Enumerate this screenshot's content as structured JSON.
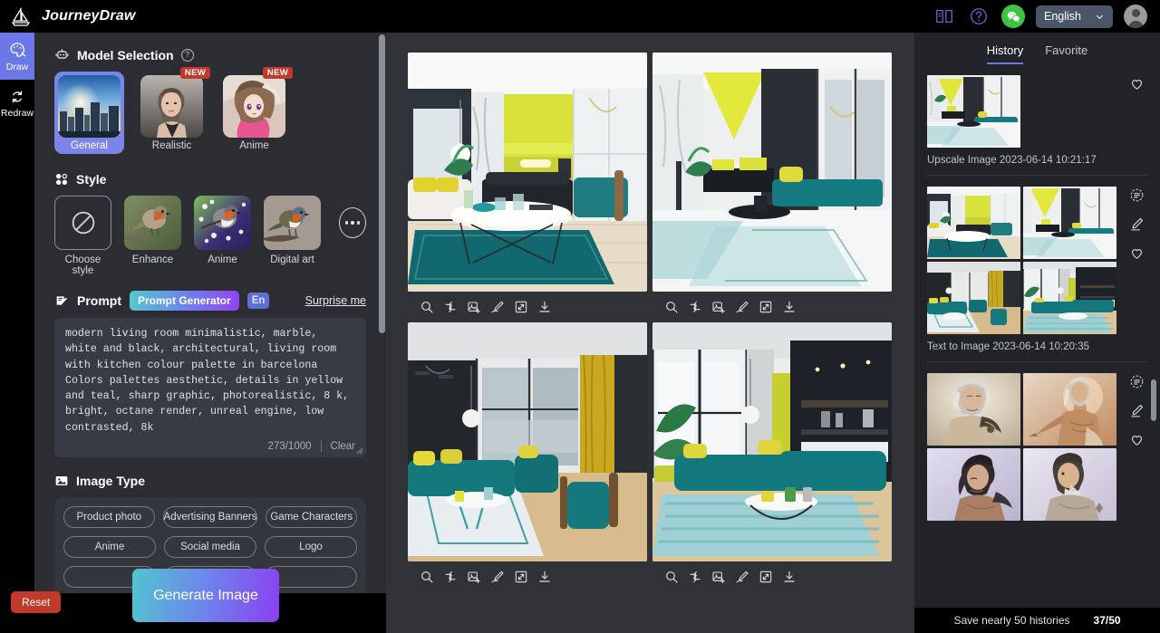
{
  "app": {
    "brand_name": "JourneyDraw",
    "logo_icon": "sailboat-icon"
  },
  "header": {
    "icons": [
      {
        "name": "book-icon",
        "label": "Docs"
      },
      {
        "name": "help-circle-icon",
        "label": "Help"
      },
      {
        "name": "wechat-icon",
        "label": "WeChat"
      }
    ],
    "language": {
      "value": "English",
      "chevron": "chevron-down-icon"
    },
    "avatar": "user-avatar"
  },
  "rail": {
    "items": [
      {
        "label": "Draw",
        "icon": "palette-brush-icon",
        "active": true
      },
      {
        "label": "Redraw",
        "icon": "refresh-cycle-icon",
        "active": false
      }
    ]
  },
  "left_panel": {
    "model_selection": {
      "title": "Model Selection",
      "help_icon": "question-circle-icon",
      "models": [
        {
          "label": "General",
          "badge": "",
          "selected": true
        },
        {
          "label": "Realistic",
          "badge": "NEW",
          "selected": false
        },
        {
          "label": "Anime",
          "badge": "NEW",
          "selected": false
        }
      ]
    },
    "style": {
      "title": "Style",
      "items": [
        {
          "label": "Choose style",
          "icon": "no-style-icon"
        },
        {
          "label": "Enhance",
          "icon": ""
        },
        {
          "label": "Anime",
          "icon": ""
        },
        {
          "label": "Digital art",
          "icon": ""
        }
      ],
      "more_icon": "ellipsis-circle-icon"
    },
    "prompt": {
      "title": "Prompt",
      "title_icon": "pencil-note-icon",
      "generator_label": "Prompt Generator",
      "lang_badge": "En",
      "surprise_label": "Surprise me",
      "value": "modern living room minimalistic, marble, white and black, architectural, living room with kitchen colour palette in barcelona Colors palettes aesthetic, details in yellow and teal, sharp graphic, photorealistic, 8 k, bright, octane render, unreal engine, low contrasted, 8k",
      "counter": "273/1000",
      "clear_label": "Clear"
    },
    "image_type": {
      "title": "Image Type",
      "title_icon": "image-icon",
      "rows": [
        [
          "Product photo",
          "Advertising Banners",
          "Game Characters"
        ],
        [
          "Anime",
          "Social media",
          "Logo"
        ]
      ]
    },
    "actions": {
      "reset_label": "Reset",
      "generate_label": "Generate Image"
    }
  },
  "canvas": {
    "tool_icons": [
      {
        "name": "search-zoom-icon",
        "label": "Zoom"
      },
      {
        "name": "variation-icon",
        "label": "Variation"
      },
      {
        "name": "image-add-icon",
        "label": "Add image"
      },
      {
        "name": "brush-edit-icon",
        "label": "Edit"
      },
      {
        "name": "expand-icon",
        "label": "Upscale"
      },
      {
        "name": "download-icon",
        "label": "Download"
      }
    ],
    "results": [
      {
        "id": "result-1",
        "alt": "modern living room yellow marble"
      },
      {
        "id": "result-2",
        "alt": "modern living room teal sofa marble"
      },
      {
        "id": "result-3",
        "alt": "living room teal sectional yellow curtains"
      },
      {
        "id": "result-4",
        "alt": "living room teal sectional kitchen"
      }
    ]
  },
  "history": {
    "tabs": [
      {
        "label": "History",
        "active": true
      },
      {
        "label": "Favorite",
        "active": false
      }
    ],
    "entries": [
      {
        "caption": "Upscale Image 2023-06-14 10:21:17",
        "thumb_count": 1,
        "actions": [
          {
            "name": "heart-icon",
            "label": "Favorite"
          }
        ]
      },
      {
        "caption": "Text to Image 2023-06-14 10:20:35",
        "thumb_count": 4,
        "actions": [
          {
            "name": "prompt-info-icon",
            "label": "Prompt"
          },
          {
            "name": "pencil-edit-icon",
            "label": "Edit"
          },
          {
            "name": "heart-icon",
            "label": "Favorite"
          }
        ]
      },
      {
        "caption": "",
        "thumb_count": 4,
        "actions": [
          {
            "name": "prompt-info-icon",
            "label": "Prompt"
          },
          {
            "name": "pencil-edit-icon",
            "label": "Edit"
          },
          {
            "name": "heart-icon",
            "label": "Favorite"
          }
        ]
      }
    ]
  },
  "footer": {
    "message": "Save nearly 50 histories",
    "count": "37/50"
  },
  "colors": {
    "accent": "#6c77e8",
    "danger": "#c0392b",
    "panel": "#2b2d33",
    "canvas": "#303238",
    "history": "#212327",
    "badge_new": "#c0392b"
  }
}
